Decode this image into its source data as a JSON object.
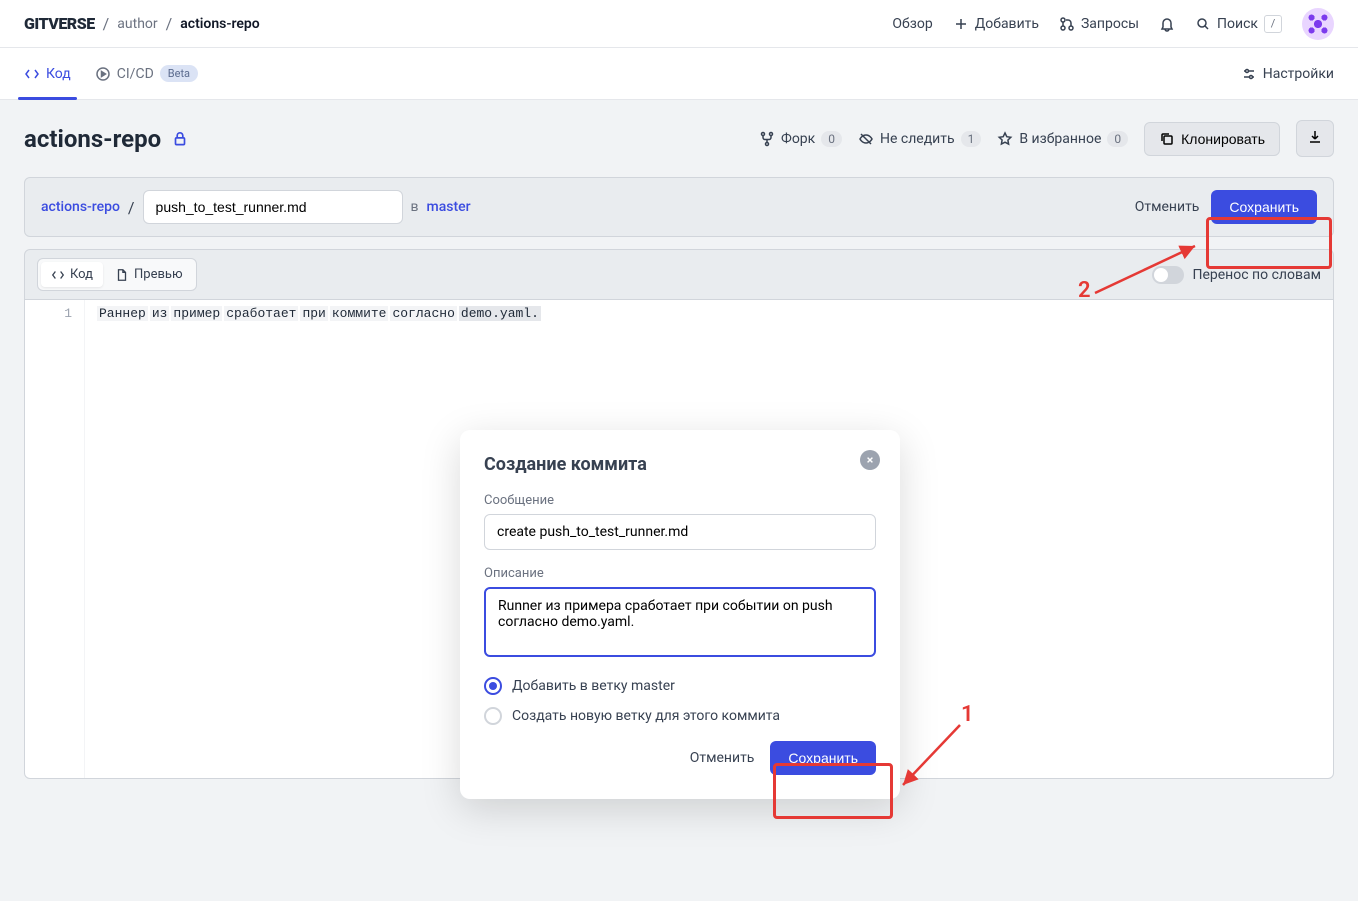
{
  "logo": "GITVERSE",
  "breadcrumb": {
    "author": "author",
    "repo": "actions-repo"
  },
  "nav": {
    "overview": "Обзор",
    "add": "Добавить",
    "requests": "Запросы",
    "search": "Поиск"
  },
  "tabs": {
    "code": "Код",
    "cicd": "CI/CD",
    "beta": "Beta",
    "settings": "Настройки"
  },
  "repo": {
    "name": "actions-repo",
    "fork": "Форк",
    "fork_count": "0",
    "unwatch": "Не следить",
    "watch_count": "1",
    "star": "В избранное",
    "star_count": "0",
    "clone": "Клонировать"
  },
  "edit": {
    "repo_link": "actions-repo",
    "filename": "push_to_test_runner.md",
    "in": "в",
    "branch": "master",
    "cancel": "Отменить",
    "save": "Сохранить"
  },
  "editor": {
    "code_tab": "Код",
    "preview_tab": "Превью",
    "wrap": "Перенос по словам",
    "line_no": "1",
    "tokens": [
      "Раннер",
      "из",
      "пример",
      "сработает",
      "при",
      "коммите",
      "согласно",
      "demo.yaml."
    ]
  },
  "modal": {
    "title": "Создание коммита",
    "msg_label": "Сообщение",
    "msg_value": "create push_to_test_runner.md",
    "desc_label": "Описание",
    "desc_value": "Runner из примера сработает при событии on push согласно demo.yaml.",
    "radio1": "Добавить в ветку master",
    "radio2": "Создать новую ветку для этого коммита",
    "cancel": "Отменить",
    "save": "Сохранить"
  },
  "annotations": {
    "n1": "1",
    "n2": "2"
  }
}
